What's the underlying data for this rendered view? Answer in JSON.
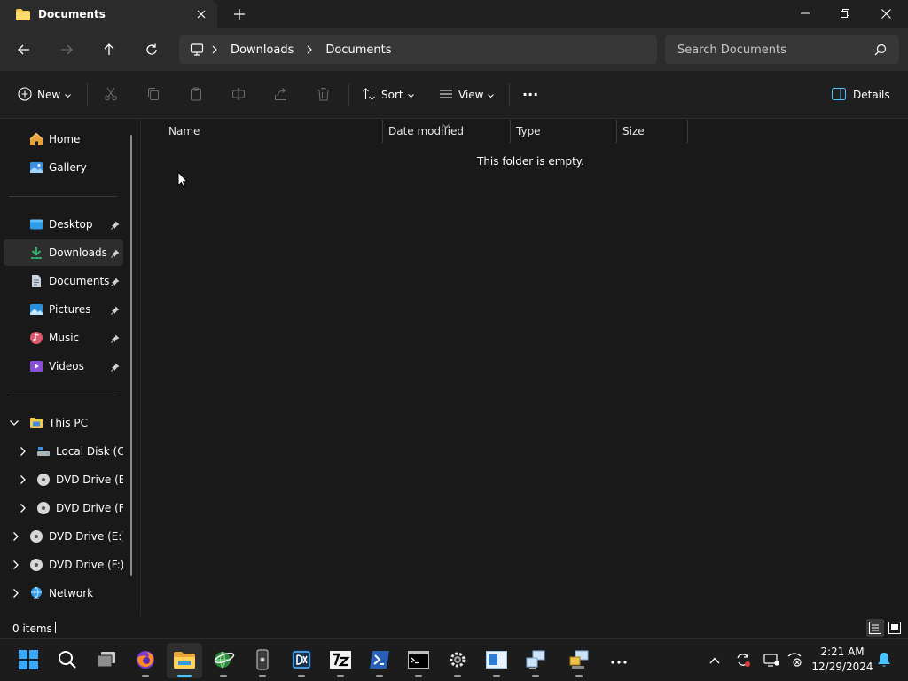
{
  "window": {
    "tab_title": "Documents",
    "new_tab": "+"
  },
  "address": {
    "crumbs": [
      "Downloads",
      "Documents"
    ],
    "search_placeholder": "Search Documents"
  },
  "toolbar": {
    "new_label": "New",
    "sort_label": "Sort",
    "view_label": "View",
    "more_label": "···",
    "details_label": "Details"
  },
  "sidebar": {
    "quick": [
      {
        "label": "Home",
        "icon": "home-icon"
      },
      {
        "label": "Gallery",
        "icon": "gallery-icon"
      }
    ],
    "pinned": [
      {
        "label": "Desktop",
        "icon": "desktop-folder-icon"
      },
      {
        "label": "Downloads",
        "icon": "downloads-folder-icon",
        "selected": true
      },
      {
        "label": "Documents",
        "icon": "documents-folder-icon"
      },
      {
        "label": "Pictures",
        "icon": "pictures-folder-icon"
      },
      {
        "label": "Music",
        "icon": "music-folder-icon"
      },
      {
        "label": "Videos",
        "icon": "videos-folder-icon"
      }
    ],
    "tree": [
      {
        "label": "This PC",
        "expanded": true
      },
      {
        "label": "Local Disk (C:)"
      },
      {
        "label": "DVD Drive (E:)"
      },
      {
        "label": "DVD Drive (F:)"
      },
      {
        "label": "DVD Drive (E:) N"
      },
      {
        "label": "DVD Drive (F:) W"
      },
      {
        "label": "Network"
      }
    ]
  },
  "columns": [
    "Name",
    "Date modified",
    "Type",
    "Size"
  ],
  "empty_message": "This folder is empty.",
  "status": {
    "items": "0 items"
  },
  "clock": {
    "time": "2:21 AM",
    "date": "12/29/2024"
  },
  "colors": {
    "accent": "#4cc2ff",
    "folder": "#f4c84a",
    "background": "#191919"
  }
}
